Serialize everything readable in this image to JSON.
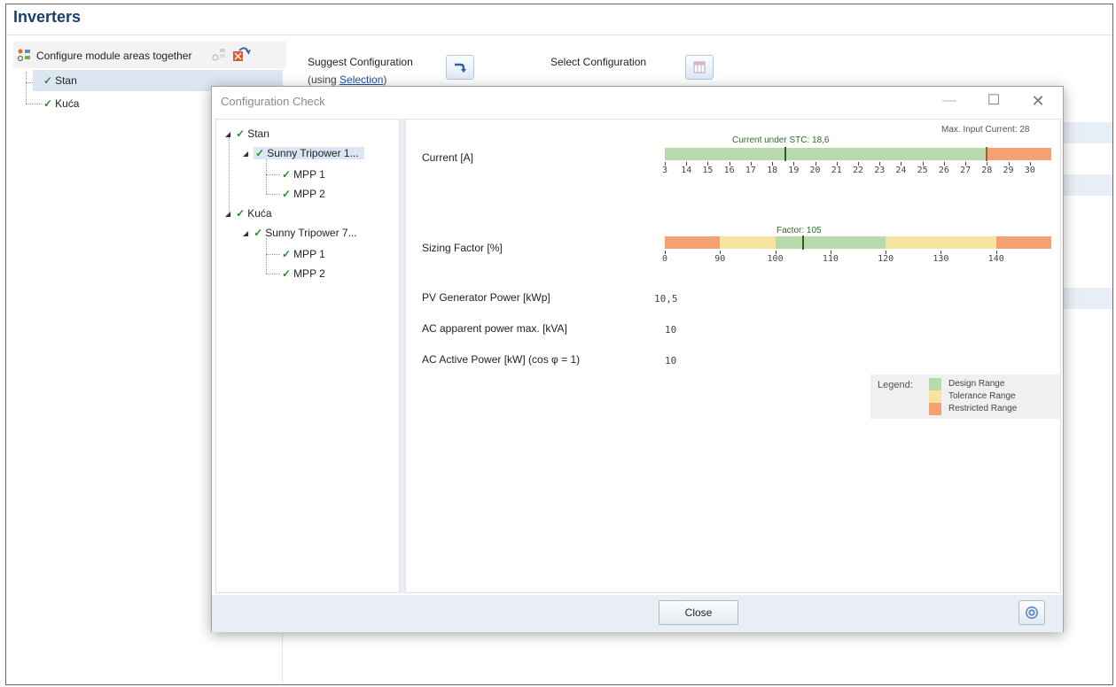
{
  "page": {
    "title": "Inverters"
  },
  "left_panel": {
    "header_label": "Configure module areas together",
    "items": [
      {
        "label": "Stan",
        "selected": true
      },
      {
        "label": "Kuća",
        "selected": false
      }
    ]
  },
  "toolbar": {
    "suggest_label": "Suggest Configuration",
    "using_prefix": "(using ",
    "using_link": "Selection",
    "using_suffix": ")",
    "select_label": "Select Configuration"
  },
  "dialog": {
    "title": "Configuration Check",
    "tree": [
      {
        "label": "Stan",
        "children": [
          {
            "label": "Sunny Tripower 1...",
            "selected": true,
            "children": [
              {
                "label": "MPP 1"
              },
              {
                "label": "MPP 2"
              }
            ]
          }
        ]
      },
      {
        "label": "Kuća",
        "children": [
          {
            "label": "Sunny Tripower 7...",
            "selected": false,
            "children": [
              {
                "label": "MPP 1"
              },
              {
                "label": "MPP 2"
              }
            ]
          }
        ]
      }
    ],
    "current": {
      "label": "Current [A]",
      "max_label": "Max. Input Current: 28",
      "stc_label": "Current under STC: 18,6",
      "stc_value": 18.6,
      "max_value": 28,
      "scale_min": 13,
      "scale_max": 31,
      "tick_labels": [
        "3",
        "14",
        "15",
        "16",
        "17",
        "18",
        "19",
        "20",
        "21",
        "22",
        "23",
        "24",
        "25",
        "26",
        "27",
        "28",
        "29",
        "30"
      ],
      "tick_values": [
        13,
        14,
        15,
        16,
        17,
        18,
        19,
        20,
        21,
        22,
        23,
        24,
        25,
        26,
        27,
        28,
        29,
        30
      ]
    },
    "sizing": {
      "label": "Sizing Factor [%]",
      "factor_label": "Factor: 105",
      "factor_value": 105,
      "scale_min": 80,
      "scale_max": 150,
      "tick_labels": [
        "0",
        "90",
        "100",
        "110",
        "120",
        "130",
        "140"
      ],
      "tick_values": [
        80,
        90,
        100,
        110,
        120,
        130,
        140
      ],
      "segments": [
        {
          "from": 80,
          "to": 90,
          "range": "restricted"
        },
        {
          "from": 90,
          "to": 100,
          "range": "tolerance"
        },
        {
          "from": 100,
          "to": 120,
          "range": "design"
        },
        {
          "from": 120,
          "to": 140,
          "range": "tolerance"
        },
        {
          "from": 140,
          "to": 150,
          "range": "restricted"
        }
      ]
    },
    "rows": [
      {
        "label": "PV Generator Power [kWp]",
        "value": "10,5"
      },
      {
        "label": "AC apparent power max. [kVA]",
        "value": "10"
      },
      {
        "label": "AC Active Power [kW] (cos φ = 1)",
        "value": "10"
      }
    ],
    "legend": {
      "title": "Legend:",
      "items": [
        {
          "label": "Design Range",
          "color": "#b9d9ad"
        },
        {
          "label": "Tolerance Range",
          "color": "#f7e3a0"
        },
        {
          "label": "Restricted Range",
          "color": "#f3a073"
        }
      ]
    },
    "close_label": "Close"
  },
  "colors": {
    "title_blue": "#1d3f6e",
    "design": "#b9d9ad",
    "tolerance": "#f7e3a0",
    "restricted": "#f3a073",
    "marker": "#2d5e2d"
  }
}
